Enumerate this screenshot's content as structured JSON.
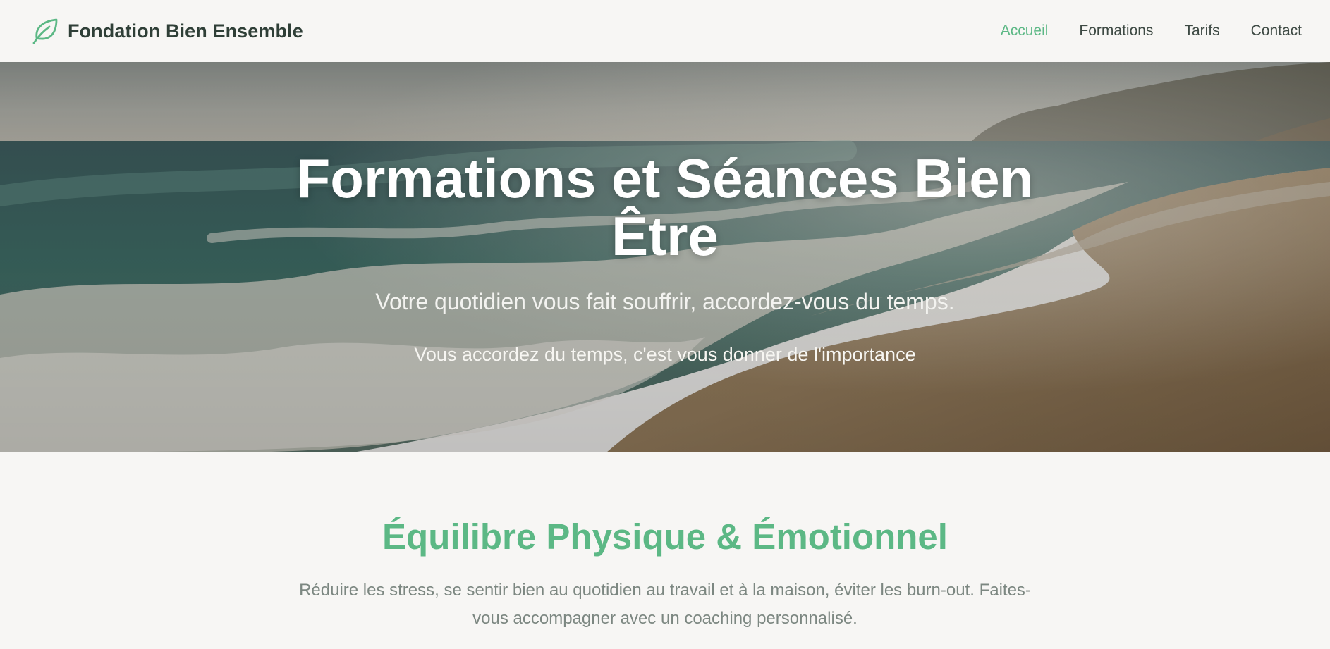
{
  "header": {
    "brand": "Fondation Bien Ensemble",
    "logo_icon": "leaf-icon",
    "nav": [
      {
        "label": "Accueil",
        "active": true
      },
      {
        "label": "Formations",
        "active": false
      },
      {
        "label": "Tarifs",
        "active": false
      },
      {
        "label": "Contact",
        "active": false
      }
    ]
  },
  "hero": {
    "title": "Formations et Séances Bien Être",
    "subtitle": "Votre quotidien vous fait souffrir, accordez-vous du temps.",
    "tagline": "Vous accordez du temps, c'est vous donner de l'importance"
  },
  "section": {
    "title": "Équilibre Physique & Émotionnel",
    "text": "Réduire les stress, se sentir bien au quotidien au travail et à la maison, éviter les burn-out. Faites-vous accompagner avec un coaching personnalisé."
  },
  "colors": {
    "accent": "#5cb885",
    "background": "#f7f6f4",
    "text_dark": "#2f3f37",
    "text_muted": "#7c8781"
  }
}
